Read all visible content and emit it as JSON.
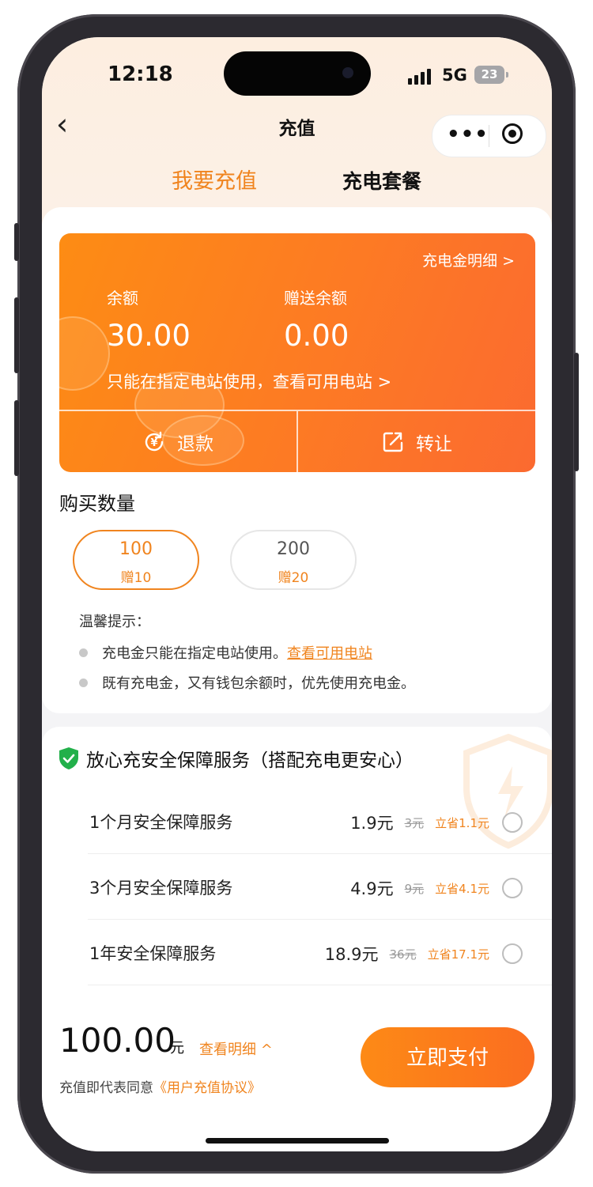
{
  "status_bar": {
    "time": "12:18",
    "network": "5G",
    "battery": "23"
  },
  "nav": {
    "back_glyph": "‹",
    "title": "充值",
    "more_glyph": "•••"
  },
  "tabs": [
    {
      "label": "我要充值",
      "active": true
    },
    {
      "label": "充电套餐",
      "active": false
    }
  ],
  "balance_card": {
    "detail_link": "充电金明细 >",
    "balance_label": "余额",
    "balance_value": "30.00",
    "gift_label": "赠送余额",
    "gift_value": "0.00",
    "station_link": "只能在指定电站使用，查看可用电站 >",
    "refund_label": "退款",
    "transfer_label": "转让",
    "refund_icon_glyph": "¥"
  },
  "quantity": {
    "title": "购买数量",
    "options": [
      {
        "amount": "100",
        "bonus": "赠10",
        "selected": true
      },
      {
        "amount": "200",
        "bonus": "赠20",
        "selected": false
      }
    ]
  },
  "tips": {
    "title": "温馨提示：",
    "item1_text": "充电金只能在指定电站使用。",
    "item1_link": "查看可用电站",
    "item2_text": "既有充电金，又有钱包余额时，优先使用充电金。"
  },
  "insurance": {
    "title": "放心充安全保障服务（搭配充电更安心）",
    "plans": [
      {
        "name": "1个月安全保障服务",
        "price": "1.9元",
        "original": "3元",
        "save": "立省1.1元"
      },
      {
        "name": "3个月安全保障服务",
        "price": "4.9元",
        "original": "9元",
        "save": "立省4.1元"
      },
      {
        "name": "1年安全保障服务",
        "price": "18.9元",
        "original": "36元",
        "save": "立省17.1元"
      }
    ]
  },
  "footer": {
    "total": "100.00",
    "unit": "元",
    "see_detail": "查看明细 ^",
    "agree_text": "充值即代表同意",
    "agree_link": "《用户充值协议》",
    "pay_label": "立即支付"
  },
  "colors": {
    "accent": "#f0841e",
    "card_start": "#fd8c14",
    "card_end": "#fb6a30"
  }
}
